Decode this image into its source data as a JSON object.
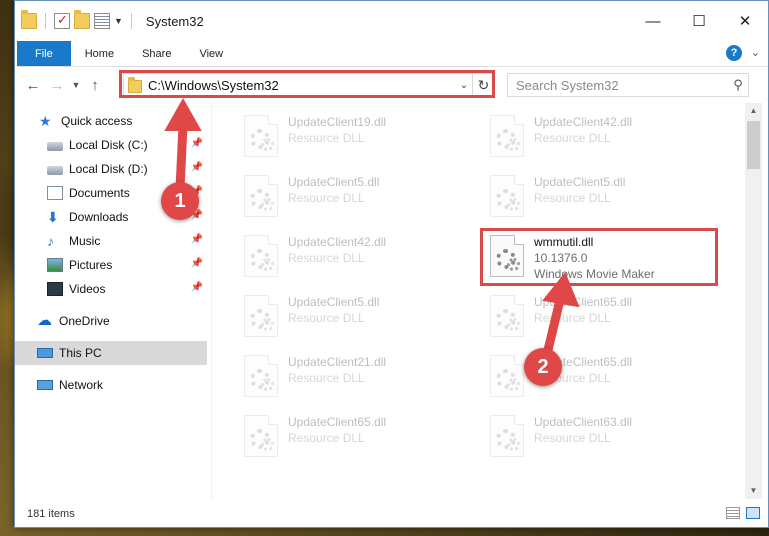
{
  "window": {
    "title": "System32",
    "buttons": {
      "minimize": "—",
      "maximize": "☐",
      "close": "✕"
    }
  },
  "ribbon": {
    "tabs": [
      {
        "label": "File",
        "active": true
      },
      {
        "label": "Home"
      },
      {
        "label": "Share"
      },
      {
        "label": "View"
      }
    ],
    "help": "?"
  },
  "navigation": {
    "address": "C:\\Windows\\System32",
    "search_placeholder": "Search System32"
  },
  "sidebar": {
    "items": [
      {
        "label": "Quick access",
        "icon": "star-icon"
      },
      {
        "label": "Local Disk (C:)",
        "icon": "drive-icon",
        "pinned": true
      },
      {
        "label": "Local Disk (D:)",
        "icon": "drive-icon",
        "pinned": true
      },
      {
        "label": "Documents",
        "icon": "documents-icon",
        "pinned": true
      },
      {
        "label": "Downloads",
        "icon": "downloads-icon",
        "pinned": true
      },
      {
        "label": "Music",
        "icon": "music-icon",
        "pinned": true
      },
      {
        "label": "Pictures",
        "icon": "pictures-icon",
        "pinned": true
      },
      {
        "label": "Videos",
        "icon": "videos-icon",
        "pinned": true
      },
      {
        "label": "OneDrive",
        "icon": "cloud-icon"
      },
      {
        "label": "This PC",
        "icon": "computer-icon",
        "selected": true
      },
      {
        "label": "Network",
        "icon": "network-icon"
      }
    ]
  },
  "files": [
    {
      "name": "UpdateClient19.dll",
      "type": "Resource DLL",
      "faded": true
    },
    {
      "name": "UpdateClient42.dll",
      "type": "Resource DLL",
      "faded": true
    },
    {
      "name": "UpdateClient5.dll",
      "type": "Resource DLL",
      "faded": true
    },
    {
      "name": "UpdateClient5.dll",
      "type": "Resource DLL",
      "faded": true
    },
    {
      "name": "UpdateClient42.dll",
      "type": "Resource DLL",
      "faded": true
    },
    {
      "name": "wmmutil.dll",
      "version": "10.1376.0",
      "type": "Windows Movie Maker",
      "faded": false
    },
    {
      "name": "UpdateClient5.dll",
      "type": "Resource DLL",
      "faded": true
    },
    {
      "name": "UpdateClient65.dll",
      "type": "Resource DLL",
      "faded": true
    },
    {
      "name": "UpdateClient21.dll",
      "type": "Resource DLL",
      "faded": true
    },
    {
      "name": "UpdateClient65.dll",
      "type": "Resource DLL",
      "faded": true
    },
    {
      "name": "UpdateClient65.dll",
      "type": "Resource DLL",
      "faded": true
    },
    {
      "name": "UpdateClient63.dll",
      "type": "Resource DLL",
      "faded": true
    }
  ],
  "status": {
    "item_count": "181 items"
  },
  "annotations": {
    "callout_1": "1",
    "callout_2": "2",
    "color": "#e04848"
  }
}
